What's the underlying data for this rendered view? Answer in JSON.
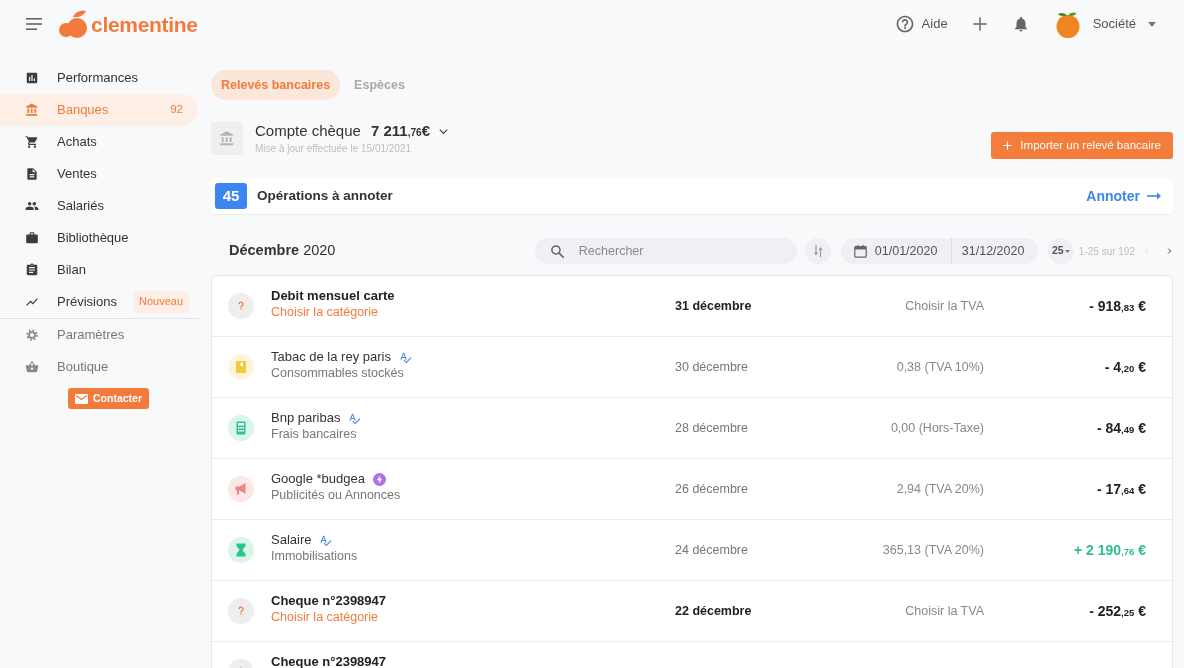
{
  "header": {
    "logo": "clementine",
    "help": "Aide",
    "company": "Société"
  },
  "sidebar": {
    "items": [
      {
        "label": "Performances",
        "selected": false
      },
      {
        "label": "Banques",
        "selected": true,
        "count": "92"
      },
      {
        "label": "Achats",
        "selected": false
      },
      {
        "label": "Ventes",
        "selected": false
      },
      {
        "label": "Salariés",
        "selected": false
      },
      {
        "label": "Bibliothèque",
        "selected": false
      },
      {
        "label": "Bilan",
        "selected": false
      },
      {
        "label": "Prévisions",
        "selected": false,
        "tag": "Nouveau"
      }
    ],
    "secondary_items": [
      {
        "label": "Paramètres"
      },
      {
        "label": "Boutique"
      }
    ],
    "contact_button": "Contacter"
  },
  "tabs": [
    {
      "label": "Relevés bancaires",
      "selected": true
    },
    {
      "label": "Espèces",
      "selected": false
    }
  ],
  "account": {
    "name": "Compte chèque",
    "balance": {
      "whole": "7 211",
      "cents": ",76",
      "currency": "€"
    },
    "updated": "Mise à jour effectuée le 15/01/2021",
    "import_button": "Importer un relevé bancaire"
  },
  "pending": {
    "count": "45",
    "label": "Opérations à annoter",
    "action": "Annoter"
  },
  "toolbar": {
    "period": "**Décembre** 2020",
    "search": {
      "placeholder": "Rechercher"
    },
    "date_from": "01/01/2020",
    "date_to": "31/12/2020",
    "page_size": "25",
    "range": "1-25 sur 192",
    "prev": {
      "disabled": true
    },
    "next": {
      "disabled": false
    }
  },
  "transactions": [
    {
      "kind": "uncategorized",
      "name": "Debit mensuel carte",
      "auto_categorized": false,
      "synced": false,
      "category": "Choisir la catégorie",
      "date": "31 décembre",
      "vat": "Choisir la TVA",
      "amount": {
        "whole": "- 918",
        "cents": ",83",
        "currency": "€"
      },
      "credit": false
    },
    {
      "kind": "supplies",
      "name": "Tabac de la rey paris",
      "auto_categorized": true,
      "synced": false,
      "category": "Consommables stockés",
      "date": "30 décembre",
      "vat": "0,38 (TVA 10%)",
      "amount": {
        "whole": "- 4",
        "cents": ",20",
        "currency": "€"
      },
      "credit": false
    },
    {
      "kind": "bank-fees",
      "name": "Bnp paribas",
      "auto_categorized": true,
      "synced": false,
      "category": "Frais bancaires",
      "date": "28 décembre",
      "vat": "0,00 (Hors-Taxe)",
      "amount": {
        "whole": "- 84",
        "cents": ",49",
        "currency": "€"
      },
      "credit": false
    },
    {
      "kind": "advertising",
      "name": "Google *budgea",
      "auto_categorized": false,
      "synced": true,
      "category": "Publicités ou Annonces",
      "date": "26 décembre",
      "vat": "2,94 (TVA 20%)",
      "amount": {
        "whole": "- 17",
        "cents": ",64",
        "currency": "€"
      },
      "credit": false
    },
    {
      "kind": "assets",
      "name": "Salaire",
      "auto_categorized": true,
      "synced": false,
      "category": "Immobilisations",
      "date": "24 décembre",
      "vat": "365,13 (TVA 20%)",
      "amount": {
        "whole": "+ 2 190",
        "cents": ",76",
        "currency": "€"
      },
      "credit": true
    },
    {
      "kind": "uncategorized",
      "name": "Cheque n°2398947",
      "auto_categorized": false,
      "synced": false,
      "category": "Choisir la catégorie",
      "date": "22 décembre",
      "vat": "Choisir la TVA",
      "amount": {
        "whole": "- 252",
        "cents": ",25",
        "currency": "€"
      },
      "credit": false
    },
    {
      "kind": "uncategorized",
      "name": "Cheque n°2398947",
      "auto_categorized": false,
      "synced": false
    }
  ]
}
